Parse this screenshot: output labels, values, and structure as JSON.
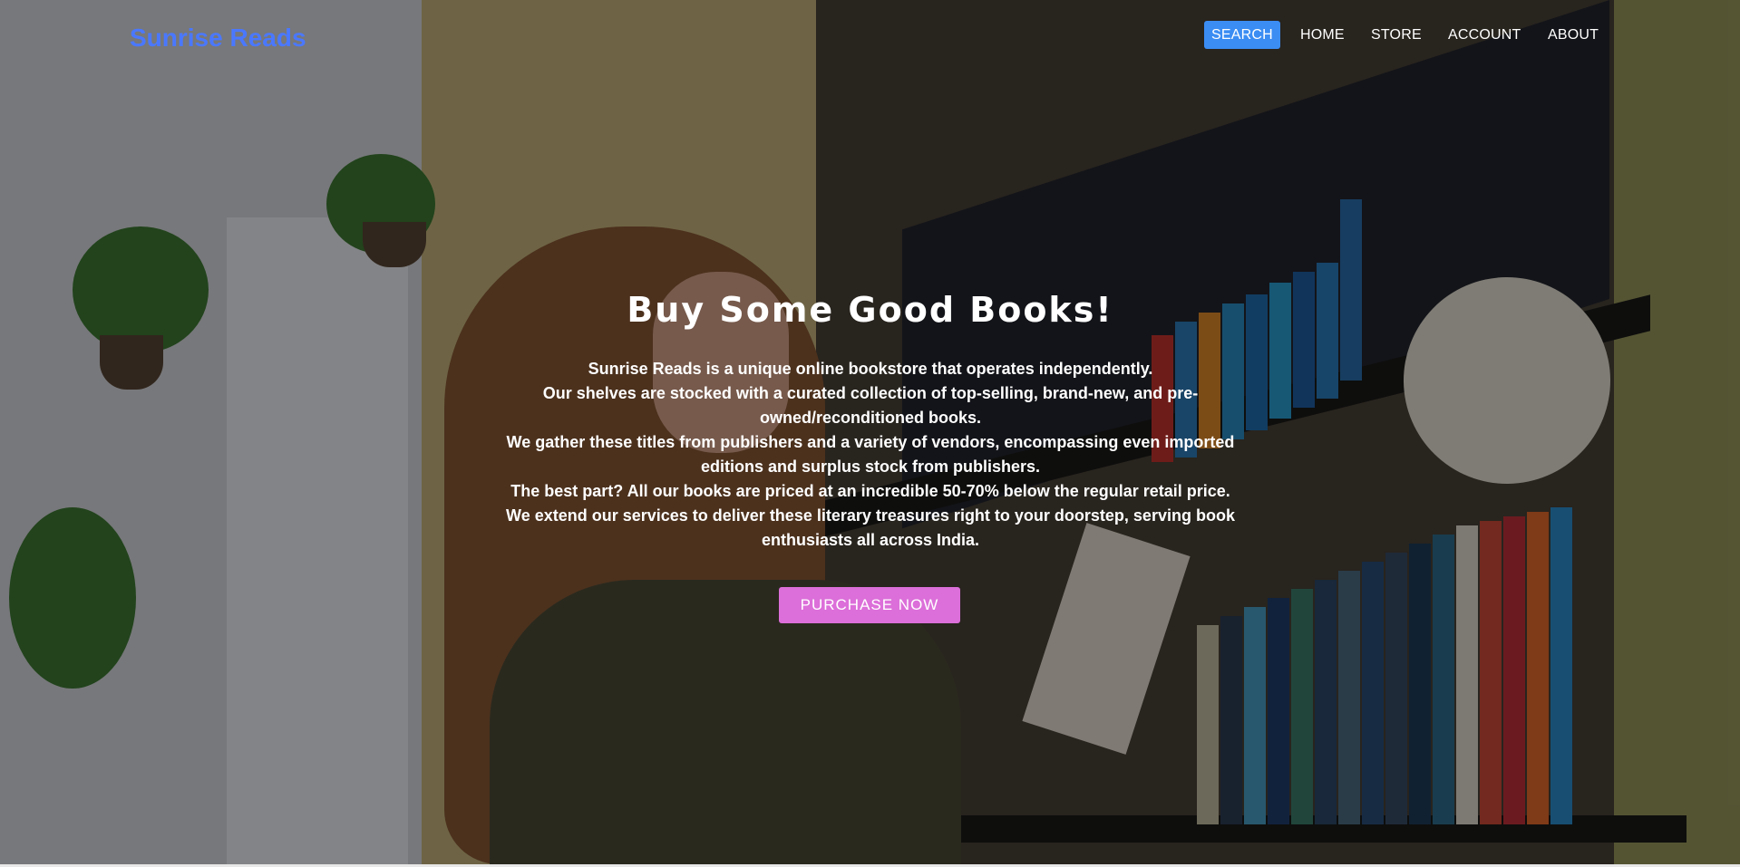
{
  "brand": {
    "name": "Sunrise Reads",
    "color": "#4a78ff"
  },
  "nav": {
    "items": [
      {
        "label": "SEARCH",
        "active": true
      },
      {
        "label": "HOME",
        "active": false
      },
      {
        "label": "STORE",
        "active": false
      },
      {
        "label": "ACCOUNT",
        "active": false
      },
      {
        "label": "ABOUT",
        "active": false
      }
    ],
    "active_color": "#3b8df3"
  },
  "hero": {
    "title": "Buy Some Good Books!",
    "paragraphs": [
      "Sunrise Reads is a unique online bookstore that operates independently.",
      "Our shelves are stocked with a curated collection of top-selling, brand-new, and pre-owned/reconditioned books.",
      "We gather these titles from publishers and a variety of vendors, encompassing even imported editions and surplus stock from publishers.",
      "The best part? All our books are priced at an incredible 50-70% below the regular retail price.",
      "We extend our services to deliver these literary treasures right to your doorstep, serving book enthusiasts all across India."
    ],
    "cta_label": "PURCHASE NOW",
    "cta_color": "#dc6fd9"
  }
}
